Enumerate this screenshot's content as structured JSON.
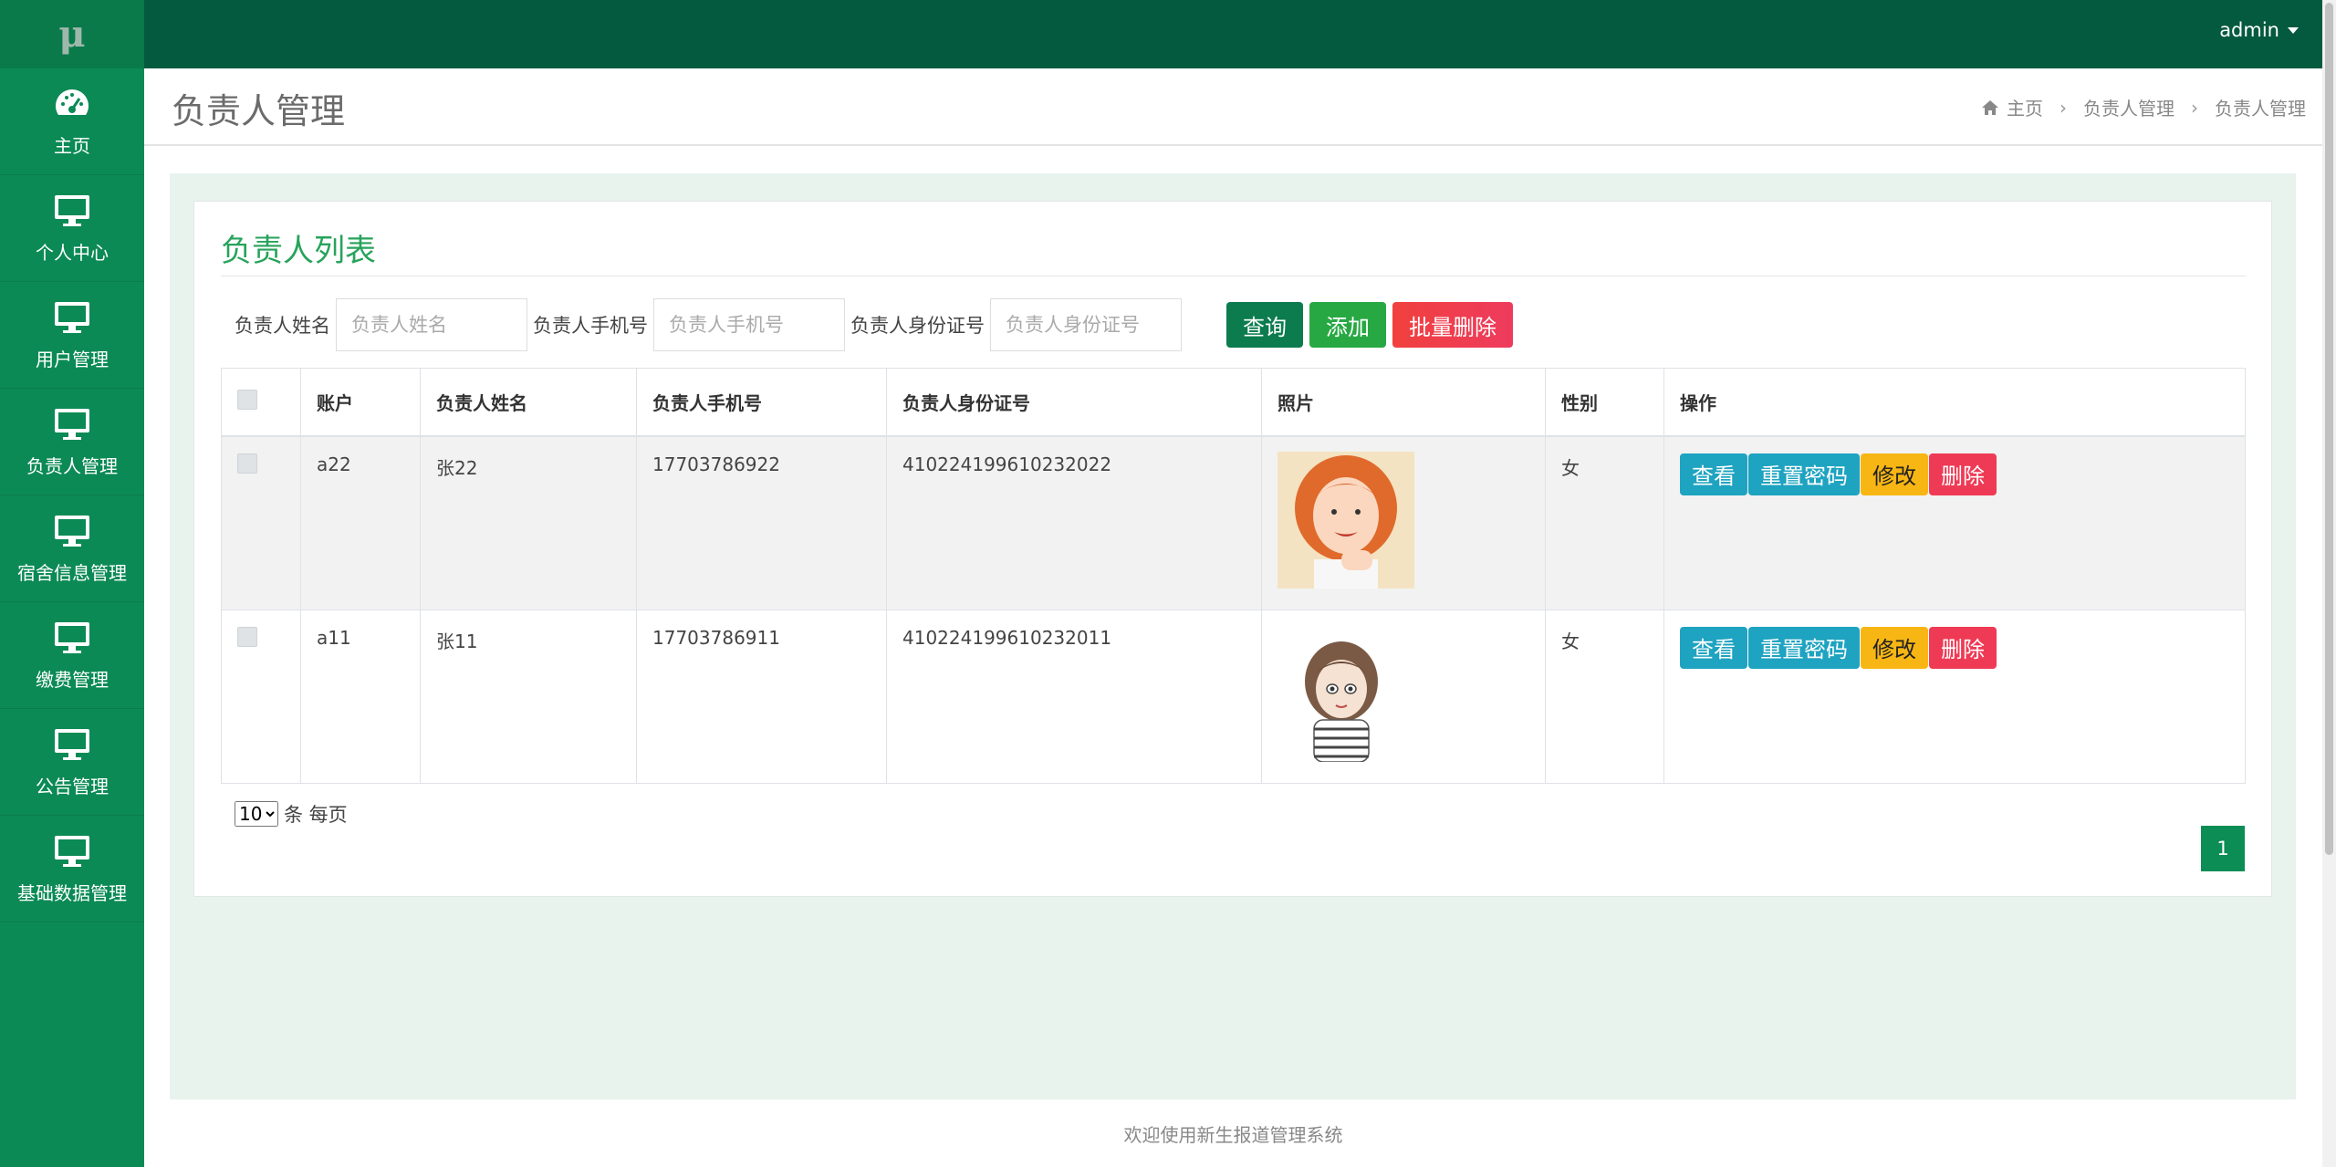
{
  "logo": {
    "text": "μ"
  },
  "sidebar": {
    "items": [
      {
        "label": "主页",
        "icon": "dashboard-icon"
      },
      {
        "label": "个人中心",
        "icon": "monitor-icon"
      },
      {
        "label": "用户管理",
        "icon": "monitor-icon"
      },
      {
        "label": "负责人管理",
        "icon": "monitor-icon"
      },
      {
        "label": "宿舍信息管理",
        "icon": "monitor-icon"
      },
      {
        "label": "缴费管理",
        "icon": "monitor-icon"
      },
      {
        "label": "公告管理",
        "icon": "monitor-icon"
      },
      {
        "label": "基础数据管理",
        "icon": "monitor-icon"
      }
    ]
  },
  "topbar": {
    "user": "admin"
  },
  "page": {
    "title": "负责人管理",
    "breadcrumb": [
      "主页",
      "负责人管理",
      "负责人管理"
    ]
  },
  "panel": {
    "title": "负责人列表",
    "search": {
      "name_label": "负责人姓名",
      "name_placeholder": "负责人姓名",
      "phone_label": "负责人手机号",
      "phone_placeholder": "负责人手机号",
      "idcard_label": "负责人身份证号",
      "idcard_placeholder": "负责人身份证号"
    },
    "buttons": {
      "query": "查询",
      "add": "添加",
      "batch_delete": "批量删除"
    }
  },
  "table": {
    "headers": [
      "账户",
      "负责人姓名",
      "负责人手机号",
      "负责人身份证号",
      "照片",
      "性别",
      "操作"
    ],
    "rows": [
      {
        "account": "a22",
        "name": "张22",
        "phone": "17703786922",
        "idcard": "410224199610232022",
        "gender": "女"
      },
      {
        "account": "a11",
        "name": "张11",
        "phone": "17703786911",
        "idcard": "410224199610232011",
        "gender": "女"
      }
    ],
    "actions": {
      "view": "查看",
      "reset": "重置密码",
      "edit": "修改",
      "delete": "删除"
    }
  },
  "pagination": {
    "page_size": "10",
    "page_size_suffix": "条 每页",
    "current_page": "1"
  },
  "footer": {
    "text": "欢迎使用新生报道管理系统"
  },
  "colors": {
    "sidebar": "#0b8a55",
    "topbar": "#045a3e",
    "accent": "#27a35b",
    "content_bg": "#e8f3ee"
  }
}
